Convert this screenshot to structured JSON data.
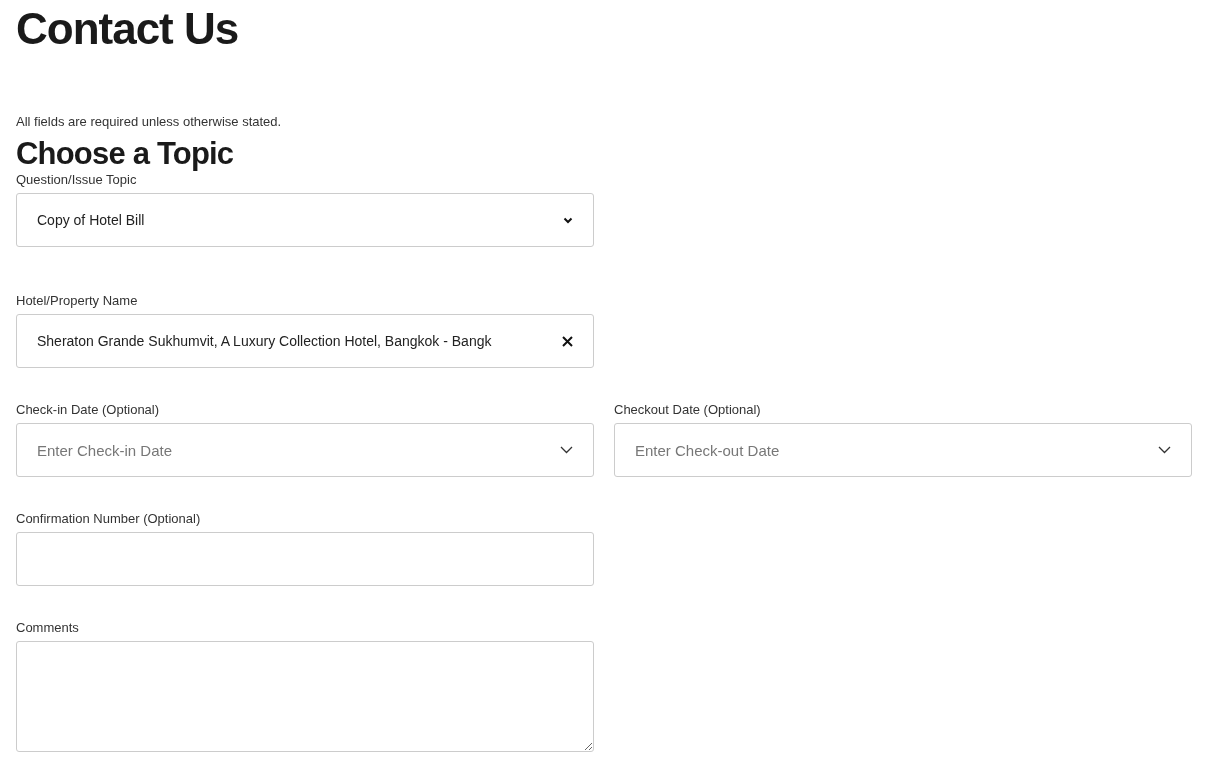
{
  "title": "Contact Us",
  "note": "All fields are required unless otherwise stated.",
  "section_title": "Choose a Topic",
  "rows": [
    {
      "fields": [
        {
          "kind": "select",
          "label": "Question/Issue Topic",
          "value": "Copy of Hotel Bill"
        }
      ]
    },
    {
      "fields": [
        {
          "kind": "clearable",
          "label": "Hotel/Property Name",
          "value": "Sheraton Grande Sukhumvit, A Luxury Collection Hotel, Bangkok - Bangk"
        }
      ]
    },
    {
      "fields": [
        {
          "kind": "date",
          "label": "Check-in Date (Optional)",
          "placeholder": "Enter Check-in Date"
        },
        {
          "kind": "date",
          "label": "Checkout Date (Optional)",
          "placeholder": "Enter Check-out Date"
        }
      ]
    },
    {
      "fields": [
        {
          "kind": "text",
          "label": "Confirmation Number (Optional)"
        }
      ]
    },
    {
      "fields": [
        {
          "kind": "textarea",
          "label": "Comments"
        }
      ]
    }
  ]
}
